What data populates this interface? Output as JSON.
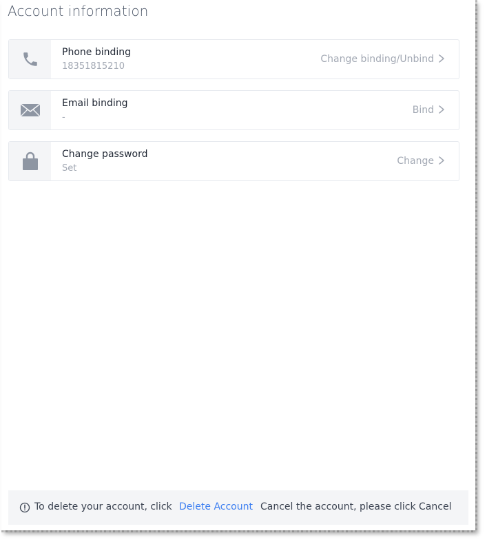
{
  "page": {
    "title": "Account information"
  },
  "rows": [
    {
      "icon": "phone-icon",
      "label": "Phone binding",
      "value": "18351815210",
      "action": "Change binding/Unbind"
    },
    {
      "icon": "email-icon",
      "label": "Email binding",
      "value": "-",
      "action": "Bind"
    },
    {
      "icon": "lock-icon",
      "label": "Change password",
      "value": "Set",
      "action": "Change"
    }
  ],
  "footer": {
    "text_before": "To delete your account, click",
    "link": "Delete Account",
    "text_after": "Cancel the account, please click Cancel"
  },
  "colors": {
    "icon": "#8e96a3",
    "link": "#3d7ff1",
    "muted_text": "#a3a9b4",
    "primary_text": "#1f2633"
  }
}
